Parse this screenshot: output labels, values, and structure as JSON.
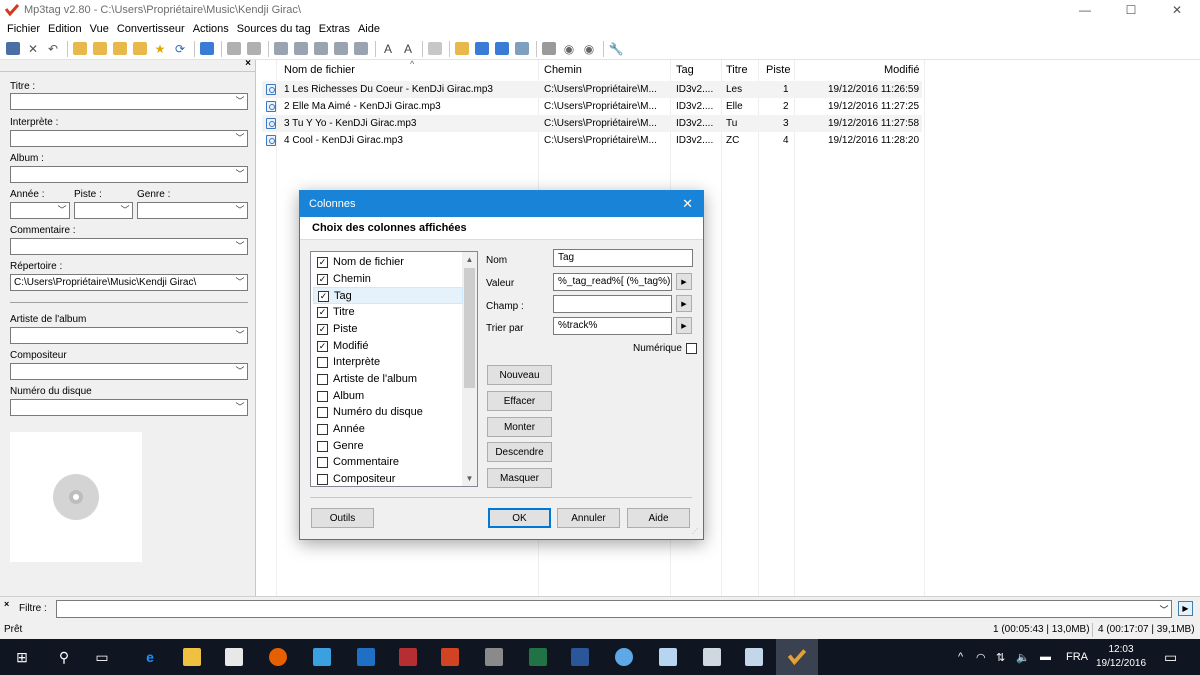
{
  "window": {
    "title": "Mp3tag v2.80  -  C:\\Users\\Propriétaire\\Music\\Kendji Girac\\",
    "minimize": "—",
    "maximize": "☐",
    "close": "✕"
  },
  "menu": [
    "Fichier",
    "Edition",
    "Vue",
    "Convertisseur",
    "Actions",
    "Sources du tag",
    "Extras",
    "Aide"
  ],
  "left_panel": {
    "close": "×",
    "titre_label": "Titre :",
    "interprete_label": "Interprète :",
    "album_label": "Album :",
    "annee_label": "Année :",
    "piste_label": "Piste :",
    "genre_label": "Genre :",
    "commentaire_label": "Commentaire :",
    "repertoire_label": "Répertoire :",
    "repertoire_value": "C:\\Users\\Propriétaire\\Music\\Kendji Girac\\",
    "artiste_album_label": "Artiste de l'album",
    "compositeur_label": "Compositeur",
    "numero_disque_label": "Numéro du disque"
  },
  "file_list": {
    "columns": {
      "filename": "Nom de fichier",
      "path": "Chemin",
      "tag": "Tag",
      "title": "Titre",
      "track": "Piste",
      "modified": "Modifié"
    },
    "rows": [
      {
        "filename": "1 Les Richesses Du Coeur - KenDJi Girac.mp3",
        "path": "C:\\Users\\Propriétaire\\M...",
        "tag": "ID3v2....",
        "title": "Les",
        "track": "1",
        "modified": "19/12/2016 11:26:59"
      },
      {
        "filename": "2 Elle Ma Aimé - KenDJi Girac.mp3",
        "path": "C:\\Users\\Propriétaire\\M...",
        "tag": "ID3v2....",
        "title": "Elle",
        "track": "2",
        "modified": "19/12/2016 11:27:25"
      },
      {
        "filename": "3 Tu Y Yo - KenDJi Girac.mp3",
        "path": "C:\\Users\\Propriétaire\\M...",
        "tag": "ID3v2....",
        "title": "Tu",
        "track": "3",
        "modified": "19/12/2016 11:27:58"
      },
      {
        "filename": "4 Cool - KenDJi Girac.mp3",
        "path": "C:\\Users\\Propriétaire\\M...",
        "tag": "ID3v2....",
        "title": "ZC",
        "track": "4",
        "modified": "19/12/2016 11:28:20"
      }
    ]
  },
  "filter": {
    "close": "×",
    "label": "Filtre :",
    "value": ""
  },
  "status": {
    "left": "Prêt",
    "selected": "1 (00:05:43 | 13,0MB)",
    "total": "4 (00:17:07 | 39,1MB)"
  },
  "dialog": {
    "title": "Colonnes",
    "close": "✕",
    "header": "Choix des colonnes affichées",
    "columns": [
      {
        "label": "Nom de fichier",
        "checked": true
      },
      {
        "label": "Chemin",
        "checked": true
      },
      {
        "label": "Tag",
        "checked": true
      },
      {
        "label": "Titre",
        "checked": true
      },
      {
        "label": "Piste",
        "checked": true
      },
      {
        "label": "Modifié",
        "checked": true
      },
      {
        "label": "Interprète",
        "checked": false
      },
      {
        "label": "Artiste de l'album",
        "checked": false
      },
      {
        "label": "Album",
        "checked": false
      },
      {
        "label": "Numéro du disque",
        "checked": false
      },
      {
        "label": "Année",
        "checked": false
      },
      {
        "label": "Genre",
        "checked": false
      },
      {
        "label": "Commentaire",
        "checked": false
      },
      {
        "label": "Compositeur",
        "checked": false
      }
    ],
    "selected_index": 2,
    "nom_label": "Nom",
    "nom_value": "Tag",
    "valeur_label": "Valeur",
    "valeur_value": "%_tag_read%[ (%_tag%)",
    "champ_label": "Champ :",
    "champ_value": "",
    "trier_label": "Trier par",
    "trier_value": "%track%",
    "numerique_label": "Numérique",
    "numerique_checked": false,
    "buttons": {
      "nouveau": "Nouveau",
      "effacer": "Effacer",
      "monter": "Monter",
      "descendre": "Descendre",
      "masquer": "Masquer",
      "outils": "Outils",
      "ok": "OK",
      "annuler": "Annuler",
      "aide": "Aide"
    }
  },
  "taskbar": {
    "language": "FRA",
    "time": "12:03",
    "date": "19/12/2016"
  },
  "colors": {
    "accent": "#1883d7",
    "taskbar": "#101621"
  }
}
